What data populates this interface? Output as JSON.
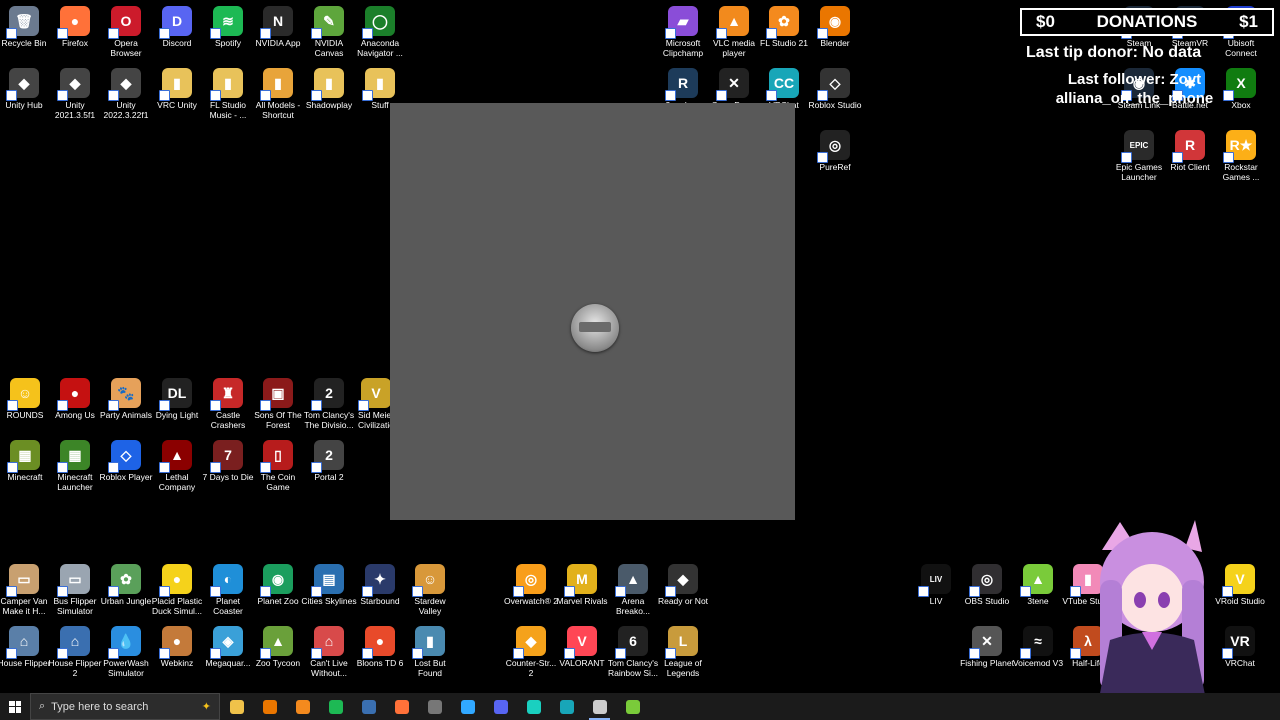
{
  "desktop": {
    "icons": [
      {
        "label": "Recycle Bin",
        "glyph": "🗑",
        "color": "#6b7a8f"
      },
      {
        "label": "Firefox",
        "glyph": "●",
        "color": "#ff7139"
      },
      {
        "label": "Opera Browser",
        "glyph": "O",
        "color": "#cc1b2b"
      },
      {
        "label": "Discord",
        "glyph": "D",
        "color": "#5865f2"
      },
      {
        "label": "Spotify",
        "glyph": "≋",
        "color": "#1db954"
      },
      {
        "label": "NVIDIA App",
        "glyph": "N",
        "color": "#2a2a2a"
      },
      {
        "label": "NVIDIA Canvas",
        "glyph": "✎",
        "color": "#5ea63c"
      },
      {
        "label": "Anaconda Navigator ...",
        "glyph": "◯",
        "color": "#1b7f2a"
      },
      {
        "label": "Unity Hub",
        "glyph": "◆",
        "color": "#444"
      },
      {
        "label": "Unity 2021.3.5f1",
        "glyph": "◆",
        "color": "#444"
      },
      {
        "label": "Unity 2022.3.22f1",
        "glyph": "◆",
        "color": "#444"
      },
      {
        "label": "VRC Unity",
        "glyph": "▮",
        "color": "#e8c25a"
      },
      {
        "label": "FL Studio Music - ...",
        "glyph": "▮",
        "color": "#e8c25a"
      },
      {
        "label": "All Models - Shortcut",
        "glyph": "▮",
        "color": "#e8a43a"
      },
      {
        "label": "Shadowplay",
        "glyph": "▮",
        "color": "#e8c25a"
      },
      {
        "label": "Stuff",
        "glyph": "▮",
        "color": "#e8c25a"
      },
      {
        "label": "Microsoft Clipchamp",
        "glyph": "▰",
        "color": "#8a4dd8"
      },
      {
        "label": "VLC media player",
        "glyph": "▲",
        "color": "#f28a1d"
      },
      {
        "label": "FL Studio 21",
        "glyph": "✿",
        "color": "#f48a1e"
      },
      {
        "label": "Blender",
        "glyph": "◉",
        "color": "#ea7600"
      },
      {
        "label": "r2modman",
        "glyph": "R",
        "color": "#1d3b5a"
      },
      {
        "label": "CurseForge",
        "glyph": "✕",
        "color": "#222"
      },
      {
        "label": "VRChat",
        "glyph": "CC",
        "color": "#18a6b8"
      },
      {
        "label": "Roblox Studio",
        "glyph": "◇",
        "color": "#333"
      },
      {
        "label": "PureRef",
        "glyph": "◎",
        "color": "#222"
      },
      {
        "label": "Steam",
        "glyph": "◉",
        "color": "#1b2838"
      },
      {
        "label": "SteamVR",
        "glyph": "◉",
        "color": "#1b2838"
      },
      {
        "label": "Ubisoft Connect",
        "glyph": "◎",
        "color": "#1f3ecf"
      },
      {
        "label": "Steam Link",
        "glyph": "◉",
        "color": "#1b2838"
      },
      {
        "label": "Battle.net",
        "glyph": "✱",
        "color": "#148eff"
      },
      {
        "label": "Xbox",
        "glyph": "X",
        "color": "#107c10"
      },
      {
        "label": "Epic Games Launcher",
        "glyph": "EPIC",
        "color": "#2a2a2a"
      },
      {
        "label": "Riot Client",
        "glyph": "R",
        "color": "#d13639"
      },
      {
        "label": "Rockstar Games ...",
        "glyph": "R★",
        "color": "#fcaf17"
      },
      {
        "label": "ROUNDS",
        "glyph": "☺",
        "color": "#f5c21b"
      },
      {
        "label": "Among Us",
        "glyph": "●",
        "color": "#c51111"
      },
      {
        "label": "Party Animals",
        "glyph": "🐾",
        "color": "#e6a15a"
      },
      {
        "label": "Dying Light",
        "glyph": "DL",
        "color": "#222"
      },
      {
        "label": "Castle Crashers",
        "glyph": "♜",
        "color": "#c62828"
      },
      {
        "label": "Sons Of The Forest",
        "glyph": "▣",
        "color": "#8b1a1a"
      },
      {
        "label": "Tom Clancy's The Divisio...",
        "glyph": "2",
        "color": "#222"
      },
      {
        "label": "Sid Meier Civilizatio",
        "glyph": "V",
        "color": "#c9a227"
      },
      {
        "label": "Minecraft",
        "glyph": "▦",
        "color": "#6b8e23"
      },
      {
        "label": "Minecraft Launcher",
        "glyph": "▦",
        "color": "#3c8527"
      },
      {
        "label": "Roblox Player",
        "glyph": "◇",
        "color": "#1e63e6"
      },
      {
        "label": "Lethal Company",
        "glyph": "▲",
        "color": "#8b0000"
      },
      {
        "label": "7 Days to Die",
        "glyph": "7",
        "color": "#7a1f1f"
      },
      {
        "label": "The Coin Game",
        "glyph": "▯",
        "color": "#b71c1c"
      },
      {
        "label": "Portal 2",
        "glyph": "2",
        "color": "#444"
      },
      {
        "label": "Camper Van Make it H...",
        "glyph": "▭",
        "color": "#c8a070"
      },
      {
        "label": "Bus Flipper Simulator",
        "glyph": "▭",
        "color": "#9aa5b1"
      },
      {
        "label": "Urban Jungle",
        "glyph": "✿",
        "color": "#5aa05a"
      },
      {
        "label": "Placid Plastic Duck Simul...",
        "glyph": "●",
        "color": "#f5d21b"
      },
      {
        "label": "Planet Coaster",
        "glyph": "◐",
        "color": "#1f8fd8"
      },
      {
        "label": "Planet Zoo",
        "glyph": "◉",
        "color": "#1b9e5e"
      },
      {
        "label": "Cities Skylines",
        "glyph": "▤",
        "color": "#2a6fb0"
      },
      {
        "label": "Starbound",
        "glyph": "✦",
        "color": "#2a3a6a"
      },
      {
        "label": "Stardew Valley",
        "glyph": "☺",
        "color": "#d8983a"
      },
      {
        "label": "Overwatch® 2",
        "glyph": "◎",
        "color": "#f99e1a"
      },
      {
        "label": "Marvel Rivals",
        "glyph": "M",
        "color": "#e2b11b"
      },
      {
        "label": "Arena Breako...",
        "glyph": "▲",
        "color": "#4a5a6a"
      },
      {
        "label": "Ready or Not",
        "glyph": "◆",
        "color": "#333"
      },
      {
        "label": "LIV",
        "glyph": "LIV",
        "color": "#111"
      },
      {
        "label": "OBS Studio",
        "glyph": "◎",
        "color": "#302e31"
      },
      {
        "label": "3tene",
        "glyph": "▲",
        "color": "#7acb3a"
      },
      {
        "label": "VTube Studio",
        "glyph": "▮",
        "color": "#f28ab8"
      },
      {
        "label": "VRoid Studio",
        "glyph": "V",
        "color": "#f5d21b"
      },
      {
        "label": "House Flipper",
        "glyph": "⌂",
        "color": "#5a7fa8"
      },
      {
        "label": "House Flipper 2",
        "glyph": "⌂",
        "color": "#3a6fb0"
      },
      {
        "label": "PowerWash Simulator",
        "glyph": "💧",
        "color": "#2a8ee0"
      },
      {
        "label": "Webkinz",
        "glyph": "●",
        "color": "#c47a3a"
      },
      {
        "label": "Megaquar...",
        "glyph": "◈",
        "color": "#3aa0d8"
      },
      {
        "label": "Zoo Tycoon",
        "glyph": "▲",
        "color": "#6aa03a"
      },
      {
        "label": "Can't Live Without...",
        "glyph": "⌂",
        "color": "#d84a4a"
      },
      {
        "label": "Bloons TD 6",
        "glyph": "●",
        "color": "#e84a2a"
      },
      {
        "label": "Lost But Found",
        "glyph": "▮",
        "color": "#4a8ab0"
      },
      {
        "label": "Counter-Str... 2",
        "glyph": "◆",
        "color": "#f5a21b"
      },
      {
        "label": "VALORANT",
        "glyph": "V",
        "color": "#ff4655"
      },
      {
        "label": "Tom Clancy's Rainbow Si...",
        "glyph": "6",
        "color": "#222"
      },
      {
        "label": "League of Legends",
        "glyph": "L",
        "color": "#c89b3c"
      },
      {
        "label": "Fishing Planet",
        "glyph": "✕",
        "color": "#555"
      },
      {
        "label": "Voicemod V3",
        "glyph": "≈",
        "color": "#111"
      },
      {
        "label": "Half-Life",
        "glyph": "λ",
        "color": "#c14b1e"
      },
      {
        "label": "VRChat",
        "glyph": "VR",
        "color": "#111"
      }
    ]
  },
  "overlay": {
    "donations_amount": "$0",
    "donations_label": "DONATIONS",
    "donations_goal": "$1",
    "last_tip_donor": "Last tip donor: No data",
    "last_follower": "Last follower: Zoyt",
    "follower_name": "alliana_on_the_phone"
  },
  "taskbar": {
    "search_placeholder": "Type here to search",
    "apps": [
      {
        "name": "file-explorer",
        "color": "#f0c24a"
      },
      {
        "name": "blender",
        "color": "#ea7600"
      },
      {
        "name": "fl-studio",
        "color": "#f48a1e"
      },
      {
        "name": "spotify",
        "color": "#1db954"
      },
      {
        "name": "steam",
        "color": "#3a6fb0"
      },
      {
        "name": "firefox",
        "color": "#ff7139"
      },
      {
        "name": "calculator",
        "color": "#777"
      },
      {
        "name": "photoshop",
        "color": "#31a8ff"
      },
      {
        "name": "discord",
        "color": "#5865f2"
      },
      {
        "name": "voicemod",
        "color": "#1ad0c0"
      },
      {
        "name": "vrchat-creator",
        "color": "#18a6b8"
      },
      {
        "name": "obs",
        "color": "#ccc"
      },
      {
        "name": "3tene",
        "color": "#7acb3a"
      }
    ]
  },
  "colors": {
    "desktop_bg": "#000000",
    "popup_bg": "#595959"
  }
}
